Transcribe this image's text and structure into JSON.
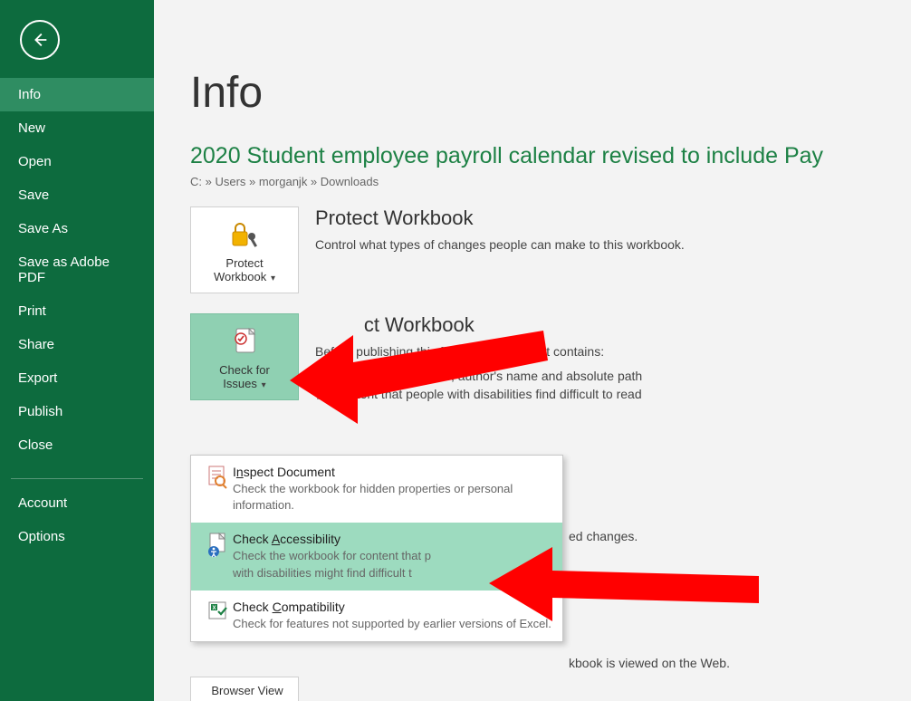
{
  "titlebar": "2020 Student employee payroll calendar revised to in",
  "sidebar": {
    "items": [
      {
        "label": "Info",
        "selected": true
      },
      {
        "label": "New"
      },
      {
        "label": "Open"
      },
      {
        "label": "Save"
      },
      {
        "label": "Save As"
      },
      {
        "label": "Save as Adobe PDF"
      },
      {
        "label": "Print"
      },
      {
        "label": "Share"
      },
      {
        "label": "Export"
      },
      {
        "label": "Publish"
      },
      {
        "label": "Close"
      }
    ],
    "bottom": [
      {
        "label": "Account"
      },
      {
        "label": "Options"
      }
    ]
  },
  "main": {
    "page_title": "Info",
    "doc_title": "2020 Student employee payroll calendar revised to include Pay ",
    "breadcrumb": "C: » Users » morganjk » Downloads",
    "protect": {
      "button_line1": "Protect",
      "button_line2": "Workbook",
      "title": "Protect Workbook",
      "desc": "Control what types of changes people can make to this workbook."
    },
    "inspect": {
      "button_line1": "Check for",
      "button_line2": "Issues",
      "title_partial": "ct Workbook",
      "desc_prefix": "Befor",
      "desc_suffix": "publishing this file, be aware that it contains:",
      "bullet1": "Document properties, author's name and absolute path",
      "bullet2": "Content that people with disabilities find difficult to read"
    },
    "behind_text1": "ed changes.",
    "behind_text2": "kbook is viewed on the Web.",
    "browser_button": "Browser View"
  },
  "dropdown": {
    "items": [
      {
        "title_pre": "I",
        "title_u": "n",
        "title_post": "spect Document",
        "desc": "Check the workbook for hidden properties or personal information."
      },
      {
        "title_pre": "Check ",
        "title_u": "A",
        "title_post": "ccessibility",
        "desc_pre": "Check the workbook for content that p",
        "desc_post": "with disabilities might find difficult t",
        "selected": true
      },
      {
        "title_pre": "Check ",
        "title_u": "C",
        "title_post": "ompatibility",
        "desc": "Check for features not supported by earlier versions of Excel."
      }
    ]
  }
}
